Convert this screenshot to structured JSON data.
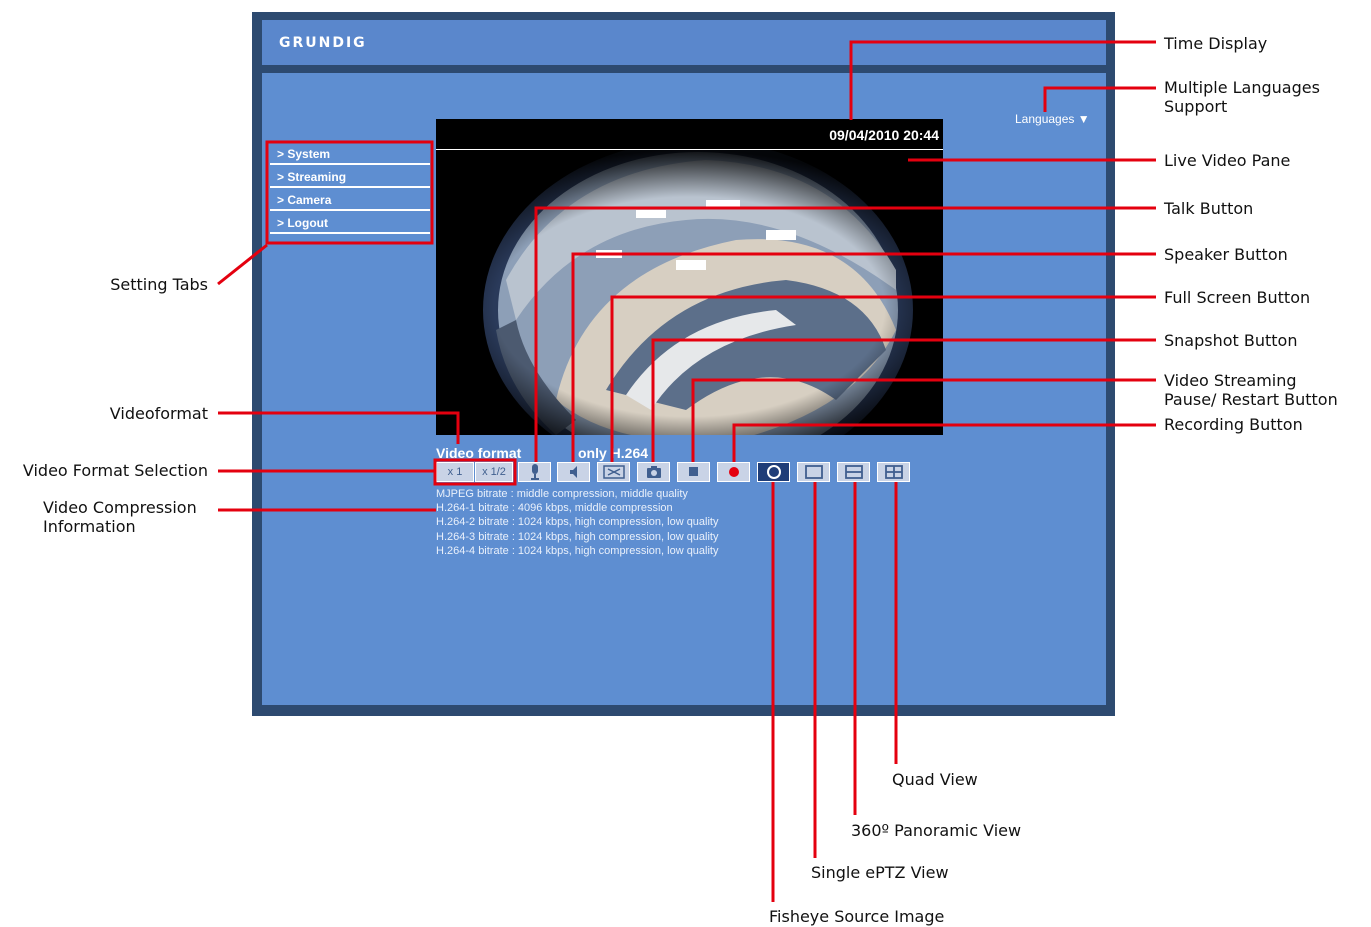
{
  "app": {
    "logo": "GRUNDIG",
    "languages_label": "Languages ▼"
  },
  "sidebar": {
    "items": [
      {
        "label": "> System"
      },
      {
        "label": "> Streaming"
      },
      {
        "label": "> Camera"
      },
      {
        "label": "> Logout"
      }
    ]
  },
  "video": {
    "timestamp": "09/04/2010 20:44",
    "format_label": "Video format",
    "format_note": "only H.264",
    "format_options": [
      "x 1",
      "x 1/2"
    ]
  },
  "controls": [
    {
      "name": "talk",
      "icon": "microphone-icon"
    },
    {
      "name": "speaker",
      "icon": "speaker-icon"
    },
    {
      "name": "full-screen",
      "icon": "fullscreen-icon"
    },
    {
      "name": "snapshot",
      "icon": "camera-icon"
    },
    {
      "name": "pause",
      "icon": "stop-icon"
    },
    {
      "name": "record",
      "icon": "record-dot-icon"
    },
    {
      "name": "fisheye-source",
      "icon": "circle-icon"
    },
    {
      "name": "single-eptz",
      "icon": "single-rect-icon"
    },
    {
      "name": "panoramic",
      "icon": "split-horizontal-icon"
    },
    {
      "name": "quad",
      "icon": "quad-grid-icon"
    }
  ],
  "info_lines": [
    "MJPEG bitrate : middle compression, middle quality",
    "H.264-1 bitrate : 4096 kbps, middle compression",
    "H.264-2 bitrate : 1024 kbps, high compression, low quality",
    "H.264-3 bitrate : 1024 kbps, high compression, low quality",
    "H.264-4 bitrate : 1024 kbps, high compression, low quality"
  ],
  "callouts": {
    "time_display": "Time Display",
    "multi_lang_1": "Multiple Languages",
    "multi_lang_2": "Support",
    "live_video": "Live Video Pane",
    "talk": "Talk Button",
    "speaker": "Speaker Button",
    "full_screen": "Full Screen Button",
    "snapshot": "Snapshot Button",
    "pause_1": "Video Streaming",
    "pause_2": "Pause/ Restart Button",
    "recording": "Recording Button",
    "setting_tabs": "Setting Tabs",
    "videoformat": "Videoformat",
    "format_selection": "Video Format Selection",
    "compression_1": "Video Compression",
    "compression_2": "Information",
    "quad_view": "Quad View",
    "panoramic": "360º Panoramic View",
    "single_eptz": "Single ePTZ View",
    "fisheye": "Fisheye Source Image"
  },
  "colors": {
    "frame": "#2d4a70",
    "panel": "#5e8ed1",
    "callout_line": "#e4000f",
    "record": "#e4000f"
  }
}
